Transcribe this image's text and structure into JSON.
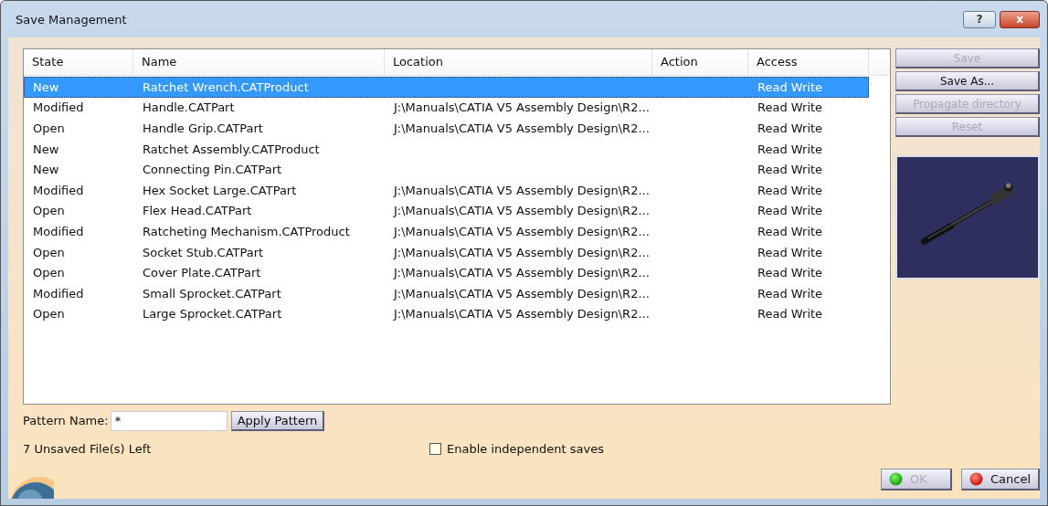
{
  "window": {
    "title": "Save Management",
    "help_button": "?",
    "close_button": "x"
  },
  "table": {
    "columns": [
      "State",
      "Name",
      "Location",
      "Action",
      "Access"
    ],
    "rows": [
      {
        "state": "New",
        "name": "Ratchet Wrench.CATProduct",
        "location": "",
        "access": "Read Write",
        "selected": true
      },
      {
        "state": "Modified",
        "name": "Handle.CATPart",
        "location": "J:\\Manuals\\CATIA V5 Assembly Design\\R2...",
        "access": "Read Write",
        "selected": false
      },
      {
        "state": "Open",
        "name": "Handle Grip.CATPart",
        "location": "J:\\Manuals\\CATIA V5 Assembly Design\\R2...",
        "access": "Read Write",
        "selected": false
      },
      {
        "state": "New",
        "name": "Ratchet Assembly.CATProduct",
        "location": "",
        "access": "Read Write",
        "selected": false
      },
      {
        "state": "New",
        "name": "Connecting Pin.CATPart",
        "location": "",
        "access": "Read Write",
        "selected": false
      },
      {
        "state": "Modified",
        "name": "Hex Socket Large.CATPart",
        "location": "J:\\Manuals\\CATIA V5 Assembly Design\\R2...",
        "access": "Read Write",
        "selected": false
      },
      {
        "state": "Open",
        "name": "Flex Head.CATPart",
        "location": "J:\\Manuals\\CATIA V5 Assembly Design\\R2...",
        "access": "Read Write",
        "selected": false
      },
      {
        "state": "Modified",
        "name": "Ratcheting Mechanism.CATProduct",
        "location": "J:\\Manuals\\CATIA V5 Assembly Design\\R2...",
        "access": "Read Write",
        "selected": false
      },
      {
        "state": "Open",
        "name": "Socket Stub.CATPart",
        "location": "J:\\Manuals\\CATIA V5 Assembly Design\\R2...",
        "access": "Read Write",
        "selected": false
      },
      {
        "state": "Open",
        "name": "Cover Plate.CATPart",
        "location": "J:\\Manuals\\CATIA V5 Assembly Design\\R2...",
        "access": "Read Write",
        "selected": false
      },
      {
        "state": "Modified",
        "name": "Small Sprocket.CATPart",
        "location": "J:\\Manuals\\CATIA V5 Assembly Design\\R2...",
        "access": "Read Write",
        "selected": false
      },
      {
        "state": "Open",
        "name": "Large Sprocket.CATPart",
        "location": "J:\\Manuals\\CATIA V5 Assembly Design\\R2...",
        "access": "Read Write",
        "selected": false
      }
    ]
  },
  "side_buttons": [
    {
      "label": "Save",
      "disabled": true
    },
    {
      "label": "Save As...",
      "disabled": false
    },
    {
      "label": "Propagate directory",
      "disabled": true
    },
    {
      "label": "Reset",
      "disabled": true
    }
  ],
  "pattern": {
    "label": "Pattern Name:",
    "value": "*",
    "button": "Apply Pattern"
  },
  "status": "7 Unsaved File(s) Left",
  "independent_saves": {
    "label": "Enable independent saves",
    "checked": false
  },
  "footer_buttons": [
    {
      "label": "OK",
      "kind": "ok",
      "disabled": true
    },
    {
      "label": "Cancel",
      "kind": "cancel",
      "disabled": false
    }
  ]
}
